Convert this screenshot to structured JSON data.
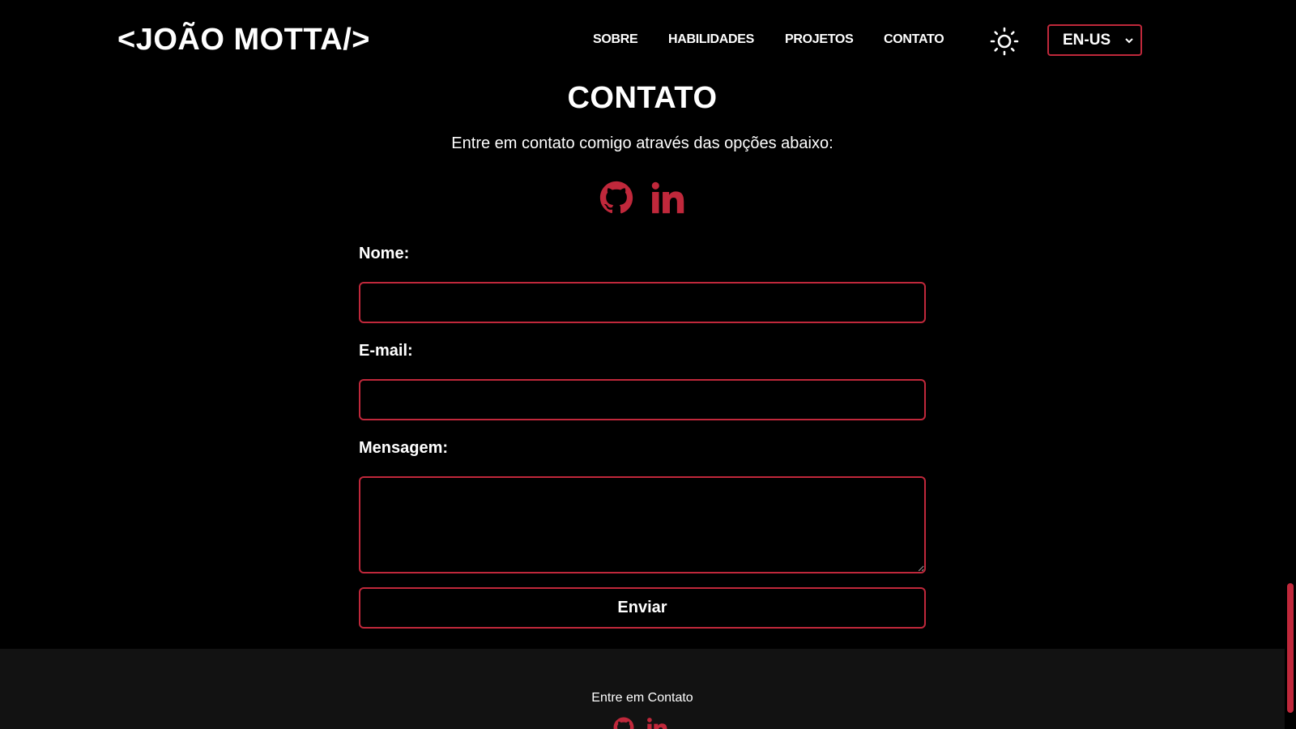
{
  "header": {
    "logo": "<JOÃO MOTTA/>",
    "nav": [
      {
        "label": "SOBRE"
      },
      {
        "label": "HABILIDADES"
      },
      {
        "label": "PROJETOS"
      },
      {
        "label": "CONTATO"
      }
    ],
    "theme_icon": "sun-icon",
    "language": {
      "selected": "EN-US"
    }
  },
  "contact": {
    "title": "CONTATO",
    "subtitle": "Entre em contato comigo através das opções abaixo:",
    "social": [
      {
        "icon": "github-icon"
      },
      {
        "icon": "linkedin-icon"
      }
    ],
    "form": {
      "name_label": "Nome:",
      "name_value": "",
      "email_label": "E-mail:",
      "email_value": "",
      "message_label": "Mensagem:",
      "message_value": "",
      "submit_label": "Enviar"
    }
  },
  "footer": {
    "text": "Entre em Contato"
  },
  "colors": {
    "accent": "#c0283b",
    "background": "#000000",
    "footer_background": "#121212",
    "text": "#ffffff"
  }
}
